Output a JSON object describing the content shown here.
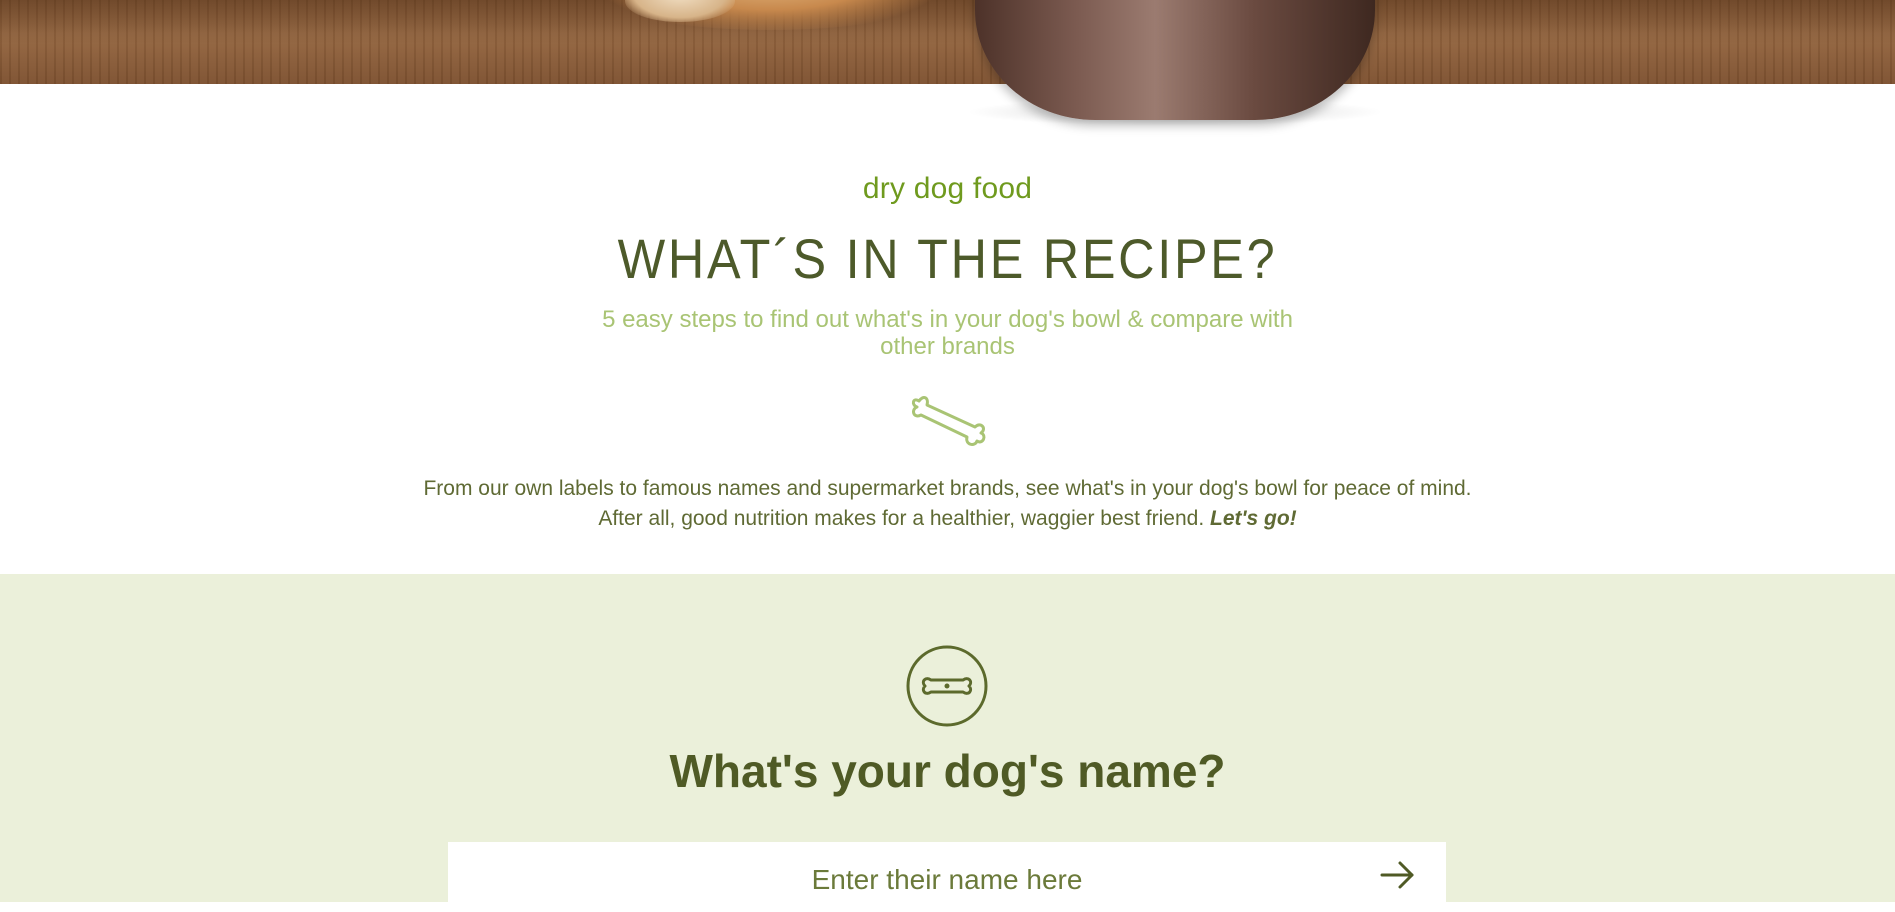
{
  "intro": {
    "eyebrow": "dry dog food",
    "title": "WHAT´S IN THE RECIPE?",
    "subtitle": "5 easy steps to find out what's in your dog's bowl & compare with other brands",
    "body_line1": "From our own labels to famous names and supermarket brands, see what's in your dog's bowl for peace of mind.",
    "body_line2": "After all, good nutrition makes for a healthier, waggier best friend.",
    "body_cta": "Let's go!",
    "divider_icon": "bone-icon"
  },
  "step": {
    "badge_icon": "bone-badge-icon",
    "question": "What's your dog's name?",
    "name_input": {
      "placeholder": "Enter their name here",
      "value": ""
    },
    "submit_icon": "arrow-right-icon"
  },
  "colors": {
    "accent_green": "#6f9a1e",
    "dark_olive": "#4d5a2a",
    "light_green": "#a9c474",
    "step_background": "#ebf0da"
  }
}
